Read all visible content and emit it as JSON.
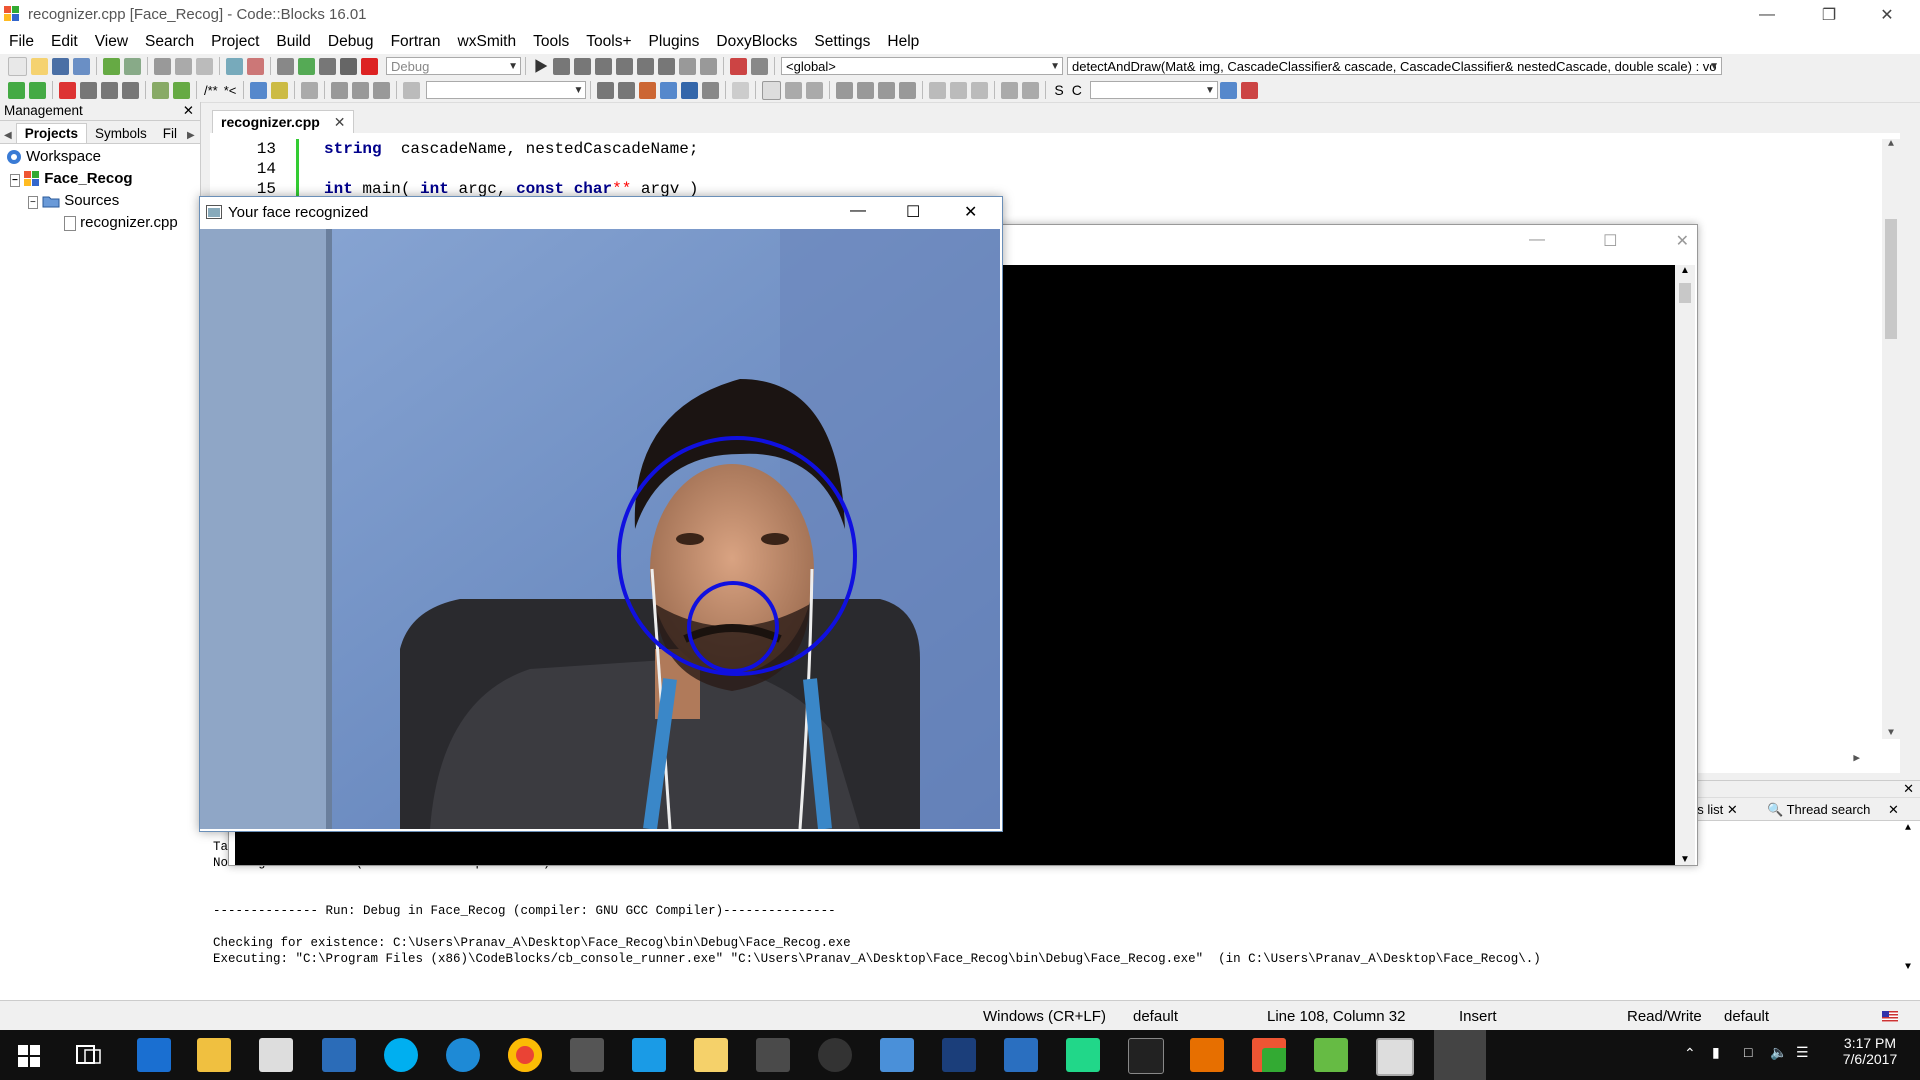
{
  "window": {
    "title": "recognizer.cpp [Face_Recog] - Code::Blocks 16.01"
  },
  "menu": [
    "File",
    "Edit",
    "View",
    "Search",
    "Project",
    "Build",
    "Debug",
    "Fortran",
    "wxSmith",
    "Tools",
    "Tools+",
    "Plugins",
    "DoxyBlocks",
    "Settings",
    "Help"
  ],
  "toolbar": {
    "build_target": "Debug",
    "scope": "<global>",
    "function": "detectAndDraw(Mat& img, CascadeClassifier& cascade, CascadeClassifier& nestedCascade, double scale) : vo",
    "doxy_comment_1": "/**",
    "doxy_comment_2": "*<",
    "symbol_s": "S",
    "symbol_c": "C"
  },
  "management": {
    "header": "Management",
    "tabs": [
      "Projects",
      "Symbols",
      "Fil"
    ],
    "tree": {
      "workspace": "Workspace",
      "project": "Face_Recog",
      "folder": "Sources",
      "file": "recognizer.cpp"
    }
  },
  "editor": {
    "tab": "recognizer.cpp",
    "lines": [
      {
        "num": "13",
        "segments": [
          [
            "kw",
            "string"
          ],
          [
            "",
            "  cascadeName, nestedCascadeName;"
          ]
        ]
      },
      {
        "num": "14",
        "segments": []
      },
      {
        "num": "15",
        "segments": [
          [
            "kw",
            "int"
          ],
          [
            "",
            " main( "
          ],
          [
            "kw",
            "int"
          ],
          [
            "",
            " argc, "
          ],
          [
            "kw",
            "const"
          ],
          [
            "",
            " "
          ],
          [
            "kw",
            "char"
          ],
          [
            "op",
            "**"
          ],
          [
            "",
            " argv )"
          ]
        ]
      }
    ]
  },
  "face_window": {
    "title": "Your face recognized"
  },
  "log_tabs": [
    "es list",
    "Thread search"
  ],
  "log": [
    "--",
    "Target is up to date.",
    "Nothing to be done (all items are up-to-date).",
    "",
    "",
    "-------------- Run: Debug in Face_Recog (compiler: GNU GCC Compiler)---------------",
    "",
    "Checking for existence: C:\\Users\\Pranav_A\\Desktop\\Face_Recog\\bin\\Debug\\Face_Recog.exe",
    "Executing: \"C:\\Program Files (x86)\\CodeBlocks/cb_console_runner.exe\" \"C:\\Users\\Pranav_A\\Desktop\\Face_Recog\\bin\\Debug\\Face_Recog.exe\"  (in C:\\Users\\Pranav_A\\Desktop\\Face_Recog\\.)"
  ],
  "status": {
    "line_endings": "Windows (CR+LF)",
    "encoding": "default",
    "position": "Line 108, Column 32",
    "mode": "Insert",
    "access": "Read/Write",
    "lang": "default"
  },
  "taskbar": {
    "time": "3:17 PM",
    "date": "7/6/2017"
  },
  "colors": {
    "accent_circle": "#1010e0",
    "taskbar": "#101010"
  }
}
